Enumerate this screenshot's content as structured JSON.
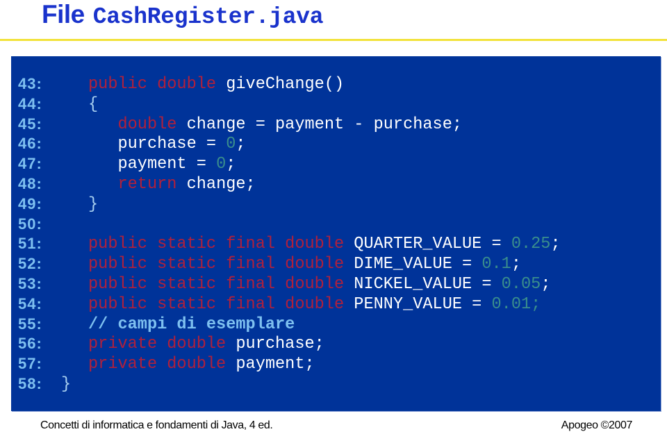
{
  "title": {
    "word": "File",
    "filename": "CashRegister.java"
  },
  "colors": {
    "title": "#1a33cc",
    "rule": "#f2e23a",
    "code_background": "#003399",
    "line_number": "#7ec0f0",
    "keyword": "#b0203c",
    "number_literal": "#3a8e8c",
    "plain_code": "#ffffff",
    "comment": "#7ec0f0"
  },
  "code_lines": [
    {
      "number": "43:",
      "tokens": [
        {
          "t": "public double",
          "k": "kw"
        },
        {
          "t": " giveChange()",
          "k": "plain"
        }
      ]
    },
    {
      "number": "44:",
      "tokens": [
        {
          "t": "{",
          "k": "brace"
        }
      ]
    },
    {
      "number": "45:",
      "tokens": [
        {
          "t": "   ",
          "k": "plain"
        },
        {
          "t": "double",
          "k": "kw"
        },
        {
          "t": " change = payment - purchase;",
          "k": "plain"
        }
      ]
    },
    {
      "number": "46:",
      "tokens": [
        {
          "t": "   purchase = ",
          "k": "plain"
        },
        {
          "t": "0",
          "k": "num"
        },
        {
          "t": ";",
          "k": "plain"
        }
      ]
    },
    {
      "number": "47:",
      "tokens": [
        {
          "t": "   payment = ",
          "k": "plain"
        },
        {
          "t": "0",
          "k": "num"
        },
        {
          "t": ";",
          "k": "plain"
        }
      ]
    },
    {
      "number": "48:",
      "tokens": [
        {
          "t": "   ",
          "k": "plain"
        },
        {
          "t": "return",
          "k": "kw"
        },
        {
          "t": " change;",
          "k": "plain"
        }
      ]
    },
    {
      "number": "49:",
      "tokens": [
        {
          "t": "}",
          "k": "brace"
        }
      ]
    },
    {
      "number": "50:",
      "tokens": []
    },
    {
      "number": "51:",
      "tokens": [
        {
          "t": "public static final double",
          "k": "kw"
        },
        {
          "t": " QUARTER_VALUE = ",
          "k": "plain"
        },
        {
          "t": "0.25",
          "k": "num"
        },
        {
          "t": ";",
          "k": "plain"
        }
      ]
    },
    {
      "number": "52:",
      "tokens": [
        {
          "t": "public static final double",
          "k": "kw"
        },
        {
          "t": " DIME_VALUE = ",
          "k": "plain"
        },
        {
          "t": "0.1",
          "k": "num"
        },
        {
          "t": ";",
          "k": "plain"
        }
      ]
    },
    {
      "number": "53:",
      "tokens": [
        {
          "t": "public static final double",
          "k": "kw"
        },
        {
          "t": " NICKEL_VALUE = ",
          "k": "plain"
        },
        {
          "t": "0.05",
          "k": "num"
        },
        {
          "t": ";",
          "k": "plain"
        }
      ]
    },
    {
      "number": "54:",
      "tokens": [
        {
          "t": "public static final double",
          "k": "kw"
        },
        {
          "t": " PENNY_VALUE = ",
          "k": "plain"
        },
        {
          "t": "0.01;",
          "k": "num"
        }
      ]
    },
    {
      "number": "55:",
      "tokens": [
        {
          "t": "// campi di esemplare",
          "k": "cmt"
        }
      ]
    },
    {
      "number": "56:",
      "tokens": [
        {
          "t": "private double",
          "k": "kw"
        },
        {
          "t": " purchase;",
          "k": "plain"
        }
      ]
    },
    {
      "number": "57:",
      "tokens": [
        {
          "t": "private double",
          "k": "kw"
        },
        {
          "t": " payment;",
          "k": "plain"
        }
      ]
    },
    {
      "number": "58:",
      "short": true,
      "tokens": [
        {
          "t": "}",
          "k": "brace"
        }
      ]
    }
  ],
  "footer": {
    "left": "Concetti di informatica e fondamenti di Java, 4 ed.",
    "right": "Apogeo ©2007"
  }
}
